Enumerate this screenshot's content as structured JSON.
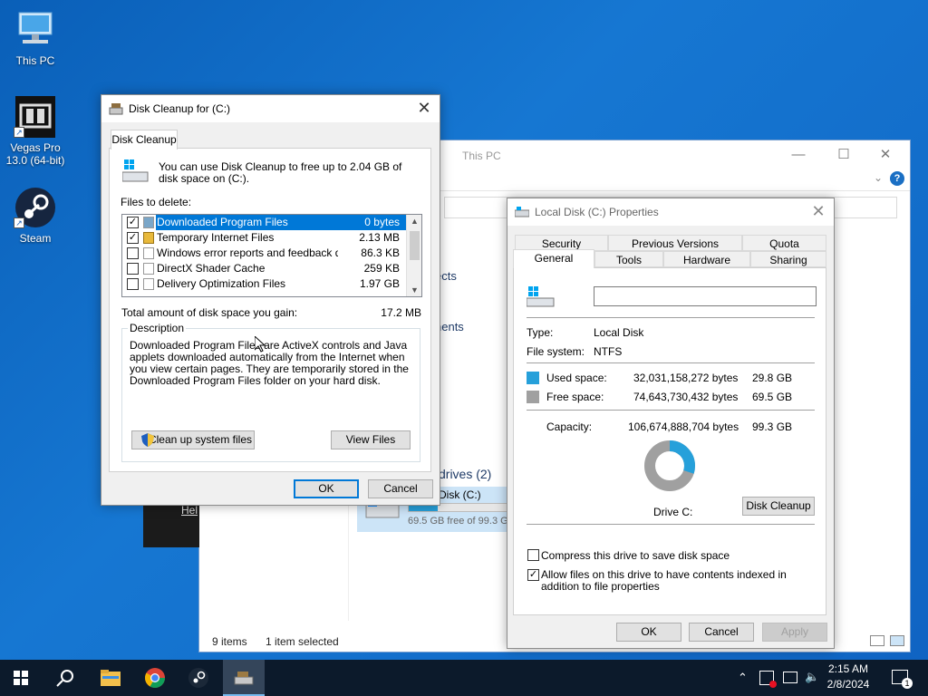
{
  "desktop": {
    "icons": [
      {
        "label": "This PC"
      },
      {
        "label": "Vegas Pro 13.0 (64-bit)"
      },
      {
        "label": "Steam"
      }
    ]
  },
  "explorer": {
    "title": "This PC",
    "content_fragments": [
      "ects",
      "nents",
      "drives (2)"
    ],
    "drive": {
      "name": "Disk (C:)",
      "free_text": "69.5 GB free of 99.3 G",
      "used_fraction": 0.3
    },
    "status": {
      "items": "9 items",
      "selected": "1 item selected"
    },
    "help_icon": "?"
  },
  "black_box_text": "Hel",
  "disk_cleanup": {
    "title": "Disk Cleanup for  (C:)",
    "tab": "Disk Cleanup",
    "intro": "You can use Disk Cleanup to free up to 2.04 GB of disk space on  (C:).",
    "files_label": "Files to delete:",
    "files": [
      {
        "checked": true,
        "locked": false,
        "name": "Downloaded Program Files",
        "size": "0 bytes",
        "selected": true
      },
      {
        "checked": true,
        "locked": true,
        "name": "Temporary Internet Files",
        "size": "2.13 MB",
        "selected": false
      },
      {
        "checked": false,
        "locked": false,
        "name": "Windows error reports and feedback di...",
        "size": "86.3 KB",
        "selected": false
      },
      {
        "checked": false,
        "locked": false,
        "name": "DirectX Shader Cache",
        "size": "259 KB",
        "selected": false
      },
      {
        "checked": false,
        "locked": false,
        "name": "Delivery Optimization Files",
        "size": "1.97 GB",
        "selected": false
      }
    ],
    "total_label": "Total amount of disk space you gain:",
    "total_value": "17.2 MB",
    "description_label": "Description",
    "description_text": "Downloaded Program Files are ActiveX controls and Java applets downloaded automatically from the Internet when you view certain pages. They are temporarily stored in the Downloaded Program Files folder on your hard disk.",
    "cleanup_system_button": "Clean up system files",
    "view_files_button": "View Files",
    "ok_button": "OK",
    "cancel_button": "Cancel"
  },
  "properties": {
    "title": "Local Disk (C:) Properties",
    "tabs_row1": [
      "Security",
      "Previous Versions",
      "Quota"
    ],
    "tabs_row2": [
      "General",
      "Tools",
      "Hardware",
      "Sharing"
    ],
    "name_value": "",
    "type_label": "Type:",
    "type_value": "Local Disk",
    "fs_label": "File system:",
    "fs_value": "NTFS",
    "used_label": "Used space:",
    "used_bytes": "32,031,158,272 bytes",
    "used_gb": "29.8 GB",
    "free_label": "Free space:",
    "free_bytes": "74,643,730,432 bytes",
    "free_gb": "69.5 GB",
    "capacity_label": "Capacity:",
    "capacity_bytes": "106,674,888,704 bytes",
    "capacity_gb": "99.3 GB",
    "drive_label": "Drive C:",
    "disk_cleanup_button": "Disk Cleanup",
    "compress_label": "Compress this drive to save disk space",
    "compress_checked": false,
    "index_label": "Allow files on this drive to have contents indexed in addition to file properties",
    "index_checked": true,
    "ok_button": "OK",
    "cancel_button": "Cancel",
    "apply_button": "Apply",
    "used_fraction": 0.3,
    "used_color": "#26a0da",
    "free_color": "#a0a0a0"
  },
  "taskbar": {
    "time": "2:15 AM",
    "date": "2/8/2024",
    "notification_count": "1"
  }
}
